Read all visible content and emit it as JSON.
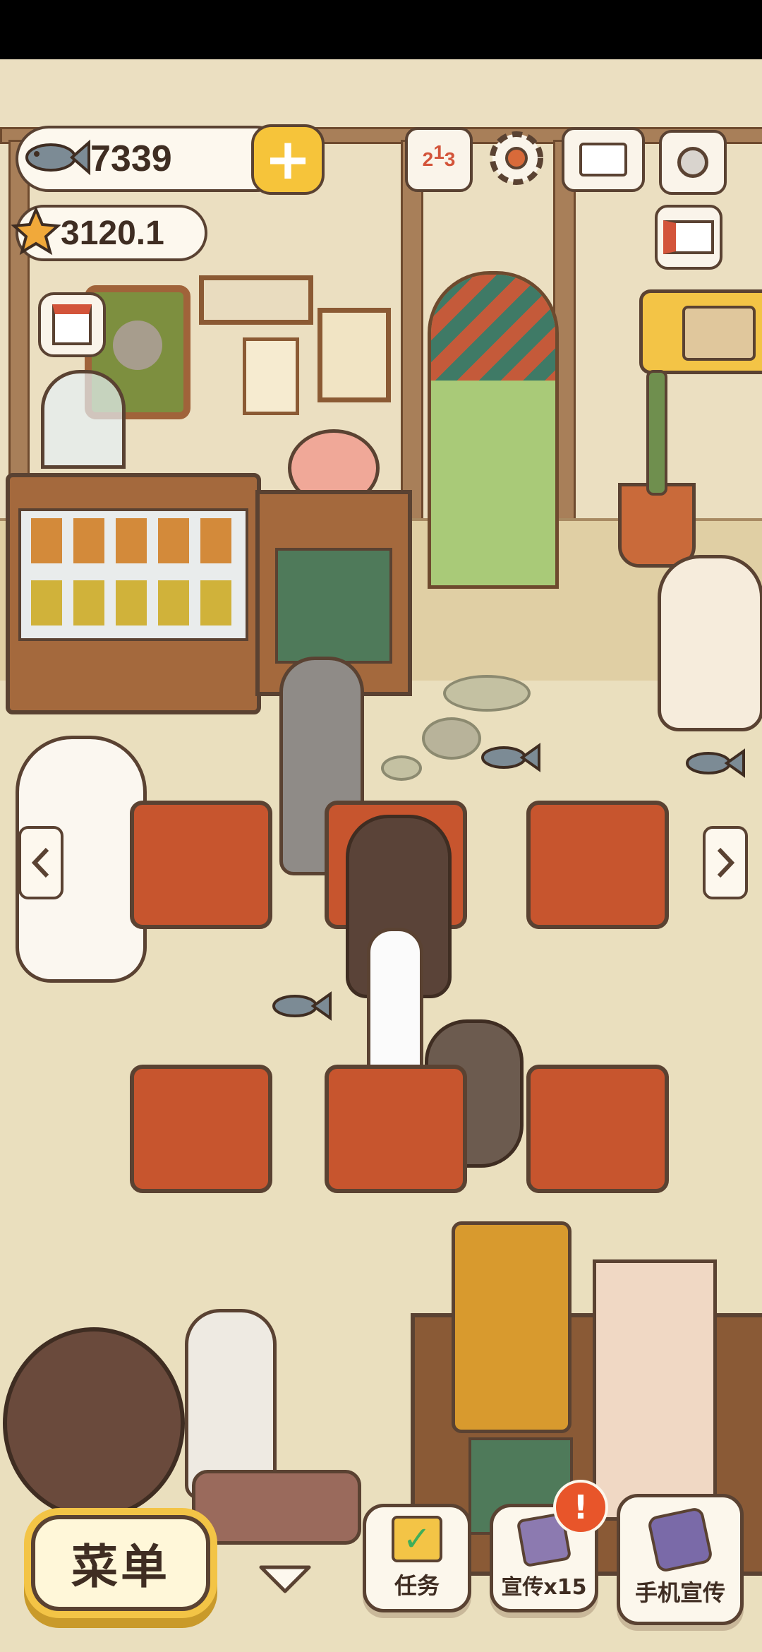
{
  "hud": {
    "fish_count": "7339",
    "star_count": "3120.1"
  },
  "buttons": {
    "menu_label": "菜单",
    "tasks_label": "任务",
    "promote_label": "宣传x15",
    "phone_promote_label": "手机宣传",
    "notification_badge": "!"
  },
  "icons": {
    "fish": "fish-icon",
    "star": "star-icon",
    "plus": "plus-icon",
    "ranking": "ranking-podium-icon",
    "settings": "gear-icon",
    "book": "recipe-book-icon",
    "camera": "camera-icon",
    "newspaper": "newspaper-icon",
    "shop": "shop-icon"
  },
  "ranking_digits": [
    "2",
    "1",
    "3"
  ],
  "colors": {
    "accent_yellow": "#f6c43a",
    "outline_brown": "#5a4232",
    "table_red": "#c7552e",
    "alert_orange": "#e8552a"
  }
}
